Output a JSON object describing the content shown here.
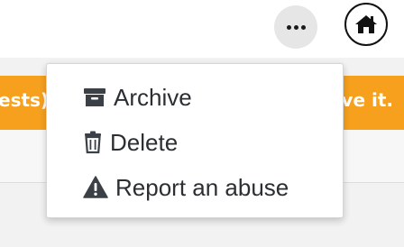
{
  "header": {
    "more_icon": "ellipsis-icon",
    "home_icon": "home-icon"
  },
  "banner": {
    "left_text": "ests)",
    "right_text": "ve it.",
    "color": "#f6a01e"
  },
  "menu": {
    "items": [
      {
        "label": "Archive",
        "icon": "archive-icon"
      },
      {
        "label": "Delete",
        "icon": "trash-icon"
      },
      {
        "label": "Report an abuse",
        "icon": "warning-icon"
      }
    ]
  }
}
